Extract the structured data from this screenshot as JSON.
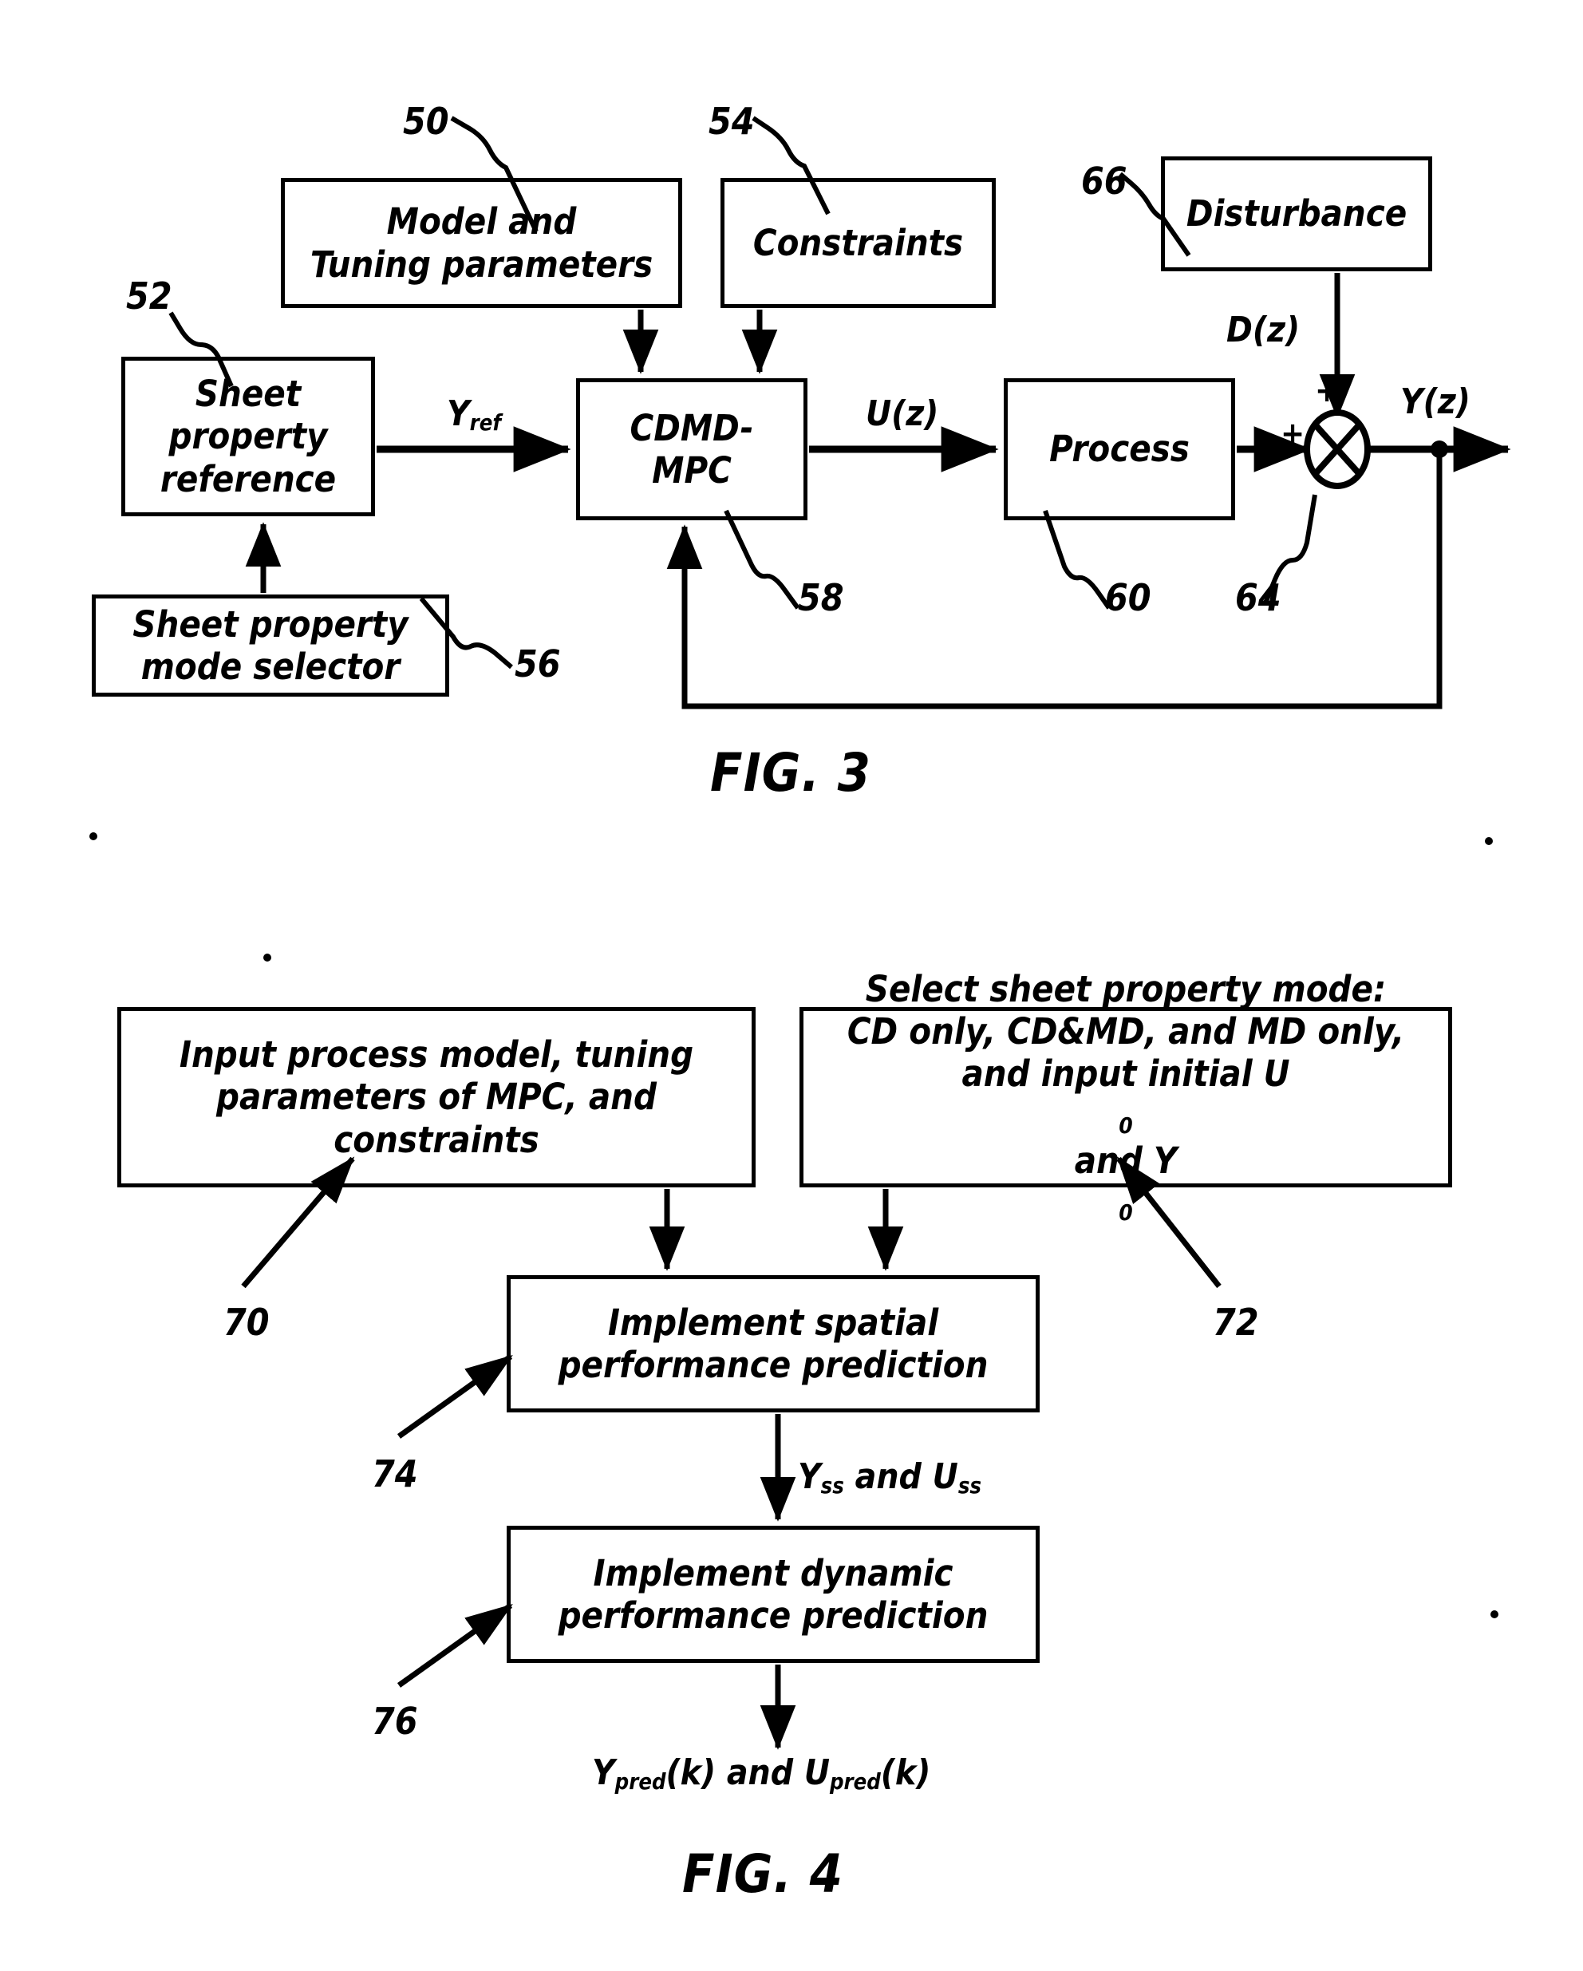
{
  "figures": [
    {
      "id": "fig3",
      "caption": "FIG. 3",
      "blocks": {
        "model_tuning": "Model and\nTuning parameters",
        "model_tuning_l1": "Model and",
        "model_tuning_l2": "Tuning parameters",
        "constraints": "Constraints",
        "disturbance": "Disturbance",
        "sheet_property_reference_l1": "Sheet",
        "sheet_property_reference_l2": "property",
        "sheet_property_reference_l3": "reference",
        "sheet_property_mode_selector_l1": "Sheet property",
        "sheet_property_mode_selector_l2": "mode selector",
        "cdmd_mpc_l1": "CDMD-",
        "cdmd_mpc_l2": "MPC",
        "process": "Process"
      },
      "signals": {
        "y_ref": "Y",
        "y_ref_sub": "ref",
        "u_z": "U(z)",
        "d_z": "D(z)",
        "y_z": "Y(z)",
        "plus_top": "+",
        "plus_left": "+"
      },
      "ref_numbers": {
        "model_tuning": "50",
        "sheet_property_reference": "52",
        "constraints": "54",
        "sheet_property_mode_selector": "56",
        "cdmd_mpc": "58",
        "process": "60",
        "summing_junction": "64",
        "disturbance": "66"
      }
    },
    {
      "id": "fig4",
      "caption": "FIG. 4",
      "blocks": {
        "input_process_model_l1": "Input process model, tuning",
        "input_process_model_l2": "parameters of MPC, and",
        "input_process_model_l3": "constraints",
        "select_mode_l1": "Select sheet property mode:",
        "select_mode_l2": "CD only, CD&MD, and MD only,",
        "select_mode_l3a": "and input initial U",
        "select_mode_l3b": "0",
        "select_mode_l3c": " and Y",
        "select_mode_l3d": "0",
        "spatial_l1": "Implement spatial",
        "spatial_l2": "performance prediction",
        "dynamic_l1": "Implement dynamic",
        "dynamic_l2": "performance prediction"
      },
      "signals": {
        "yss_uss_a": "Y",
        "yss_uss_a_sub": "ss",
        "yss_uss_mid": " and U",
        "yss_uss_b_sub": "ss",
        "ypred_a": "Y",
        "ypred_a_sub": "pred",
        "ypred_mid": "(k) and U",
        "ypred_b_sub": "pred",
        "ypred_tail": "(k)"
      },
      "ref_numbers": {
        "input_process_model": "70",
        "select_mode": "72",
        "spatial_prediction": "74",
        "dynamic_prediction": "76"
      }
    }
  ],
  "colors": {
    "ink": "#000000",
    "paper": "#ffffff"
  }
}
